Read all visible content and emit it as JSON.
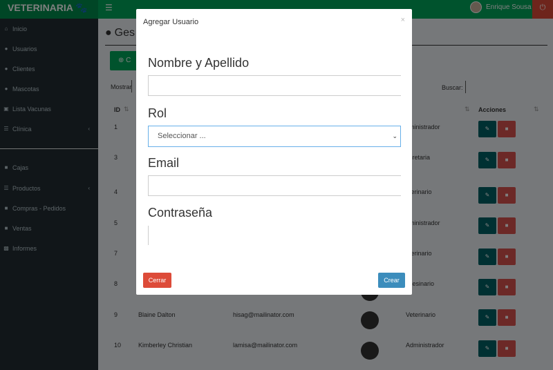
{
  "app": {
    "brand": "VETERINARIA",
    "brand_icon": "paw-icon",
    "user_name": "Enrique Sousa"
  },
  "sidebar": {
    "items": [
      {
        "label": "Inicio",
        "icon": "home-icon",
        "has_submenu": false
      },
      {
        "label": "Usuarios",
        "icon": "users-icon",
        "has_submenu": false
      },
      {
        "label": "Clientes",
        "icon": "user-plus-icon",
        "has_submenu": false
      },
      {
        "label": "Mascotas",
        "icon": "paw-icon",
        "has_submenu": false
      },
      {
        "label": "Lista Vacunas",
        "icon": "camera-icon",
        "has_submenu": false
      },
      {
        "label": "Clínica",
        "icon": "list-icon",
        "has_submenu": true
      },
      {
        "label": "Cajas",
        "icon": "briefcase-icon",
        "has_submenu": false
      },
      {
        "label": "Productos",
        "icon": "list-icon",
        "has_submenu": true
      },
      {
        "label": "Compras - Pedidos",
        "icon": "truck-icon",
        "has_submenu": false
      },
      {
        "label": "Ventas",
        "icon": "cart-icon",
        "has_submenu": false
      },
      {
        "label": "Informes",
        "icon": "bar-chart-icon",
        "has_submenu": false
      }
    ]
  },
  "main": {
    "title": "Ges",
    "create_label": "C",
    "mostrar_label": "Mostrar",
    "buscar_label": "Buscar:",
    "columns": {
      "id": "ID",
      "role_partial": "l",
      "acciones": "Acciones"
    },
    "rows": [
      {
        "id": "1",
        "name": "",
        "email": "",
        "role": "ministrador",
        "photo": false
      },
      {
        "id": "3",
        "name": "",
        "email": "",
        "role": "cretaria",
        "photo": false
      },
      {
        "id": "4",
        "name": "",
        "email": "",
        "role": "terinario",
        "photo": false
      },
      {
        "id": "5",
        "name": "",
        "email": "",
        "role": "ministrador",
        "photo": false
      },
      {
        "id": "7",
        "name": "",
        "email": "",
        "role": "terinario",
        "photo": false
      },
      {
        "id": "8",
        "name": "",
        "email": "",
        "role": "cesinario",
        "photo": true
      },
      {
        "id": "9",
        "name": "Blaine Dalton",
        "email": "hisag@mailinator.com",
        "role": "Veterinario",
        "photo": true
      },
      {
        "id": "10",
        "name": "Kimberley Christian",
        "email": "lamisa@mailinator.com",
        "role": "Administrador",
        "photo": true
      }
    ]
  },
  "modal": {
    "title": "Agregar Usuario",
    "close_glyph": "×",
    "fields": {
      "name_label": "Nombre y Apellido",
      "role_label": "Rol",
      "role_selected": "Seleccionar ...",
      "email_label": "Email",
      "password_label": "Contraseña"
    },
    "cerrar_label": "Cerrar",
    "crear_label": "Crear"
  },
  "colors": {
    "topbar": "#00a65a",
    "sidebar": "#222d32",
    "edit_button": "#006064",
    "delete_button": "#d9534f",
    "cerrar_button": "#dd4b39",
    "crear_button": "#3c8dbc"
  }
}
